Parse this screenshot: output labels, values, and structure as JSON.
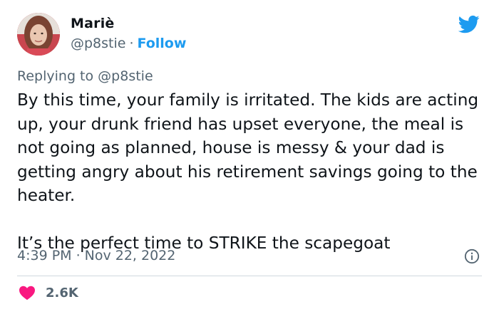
{
  "author": {
    "name": "Mariè",
    "handle": "@p8stie",
    "separator": "·",
    "follow_label": "Follow"
  },
  "reply": {
    "prefix": "Replying to",
    "mention": "@p8stie"
  },
  "tweet": {
    "paragraph1": "By this time, your family is irritated. The kids are acting up, your drunk friend has upset everyone, the meal is not going as planned, house is messy & your dad is getting angry about his retirement savings going to the heater.",
    "paragraph2": "It’s the perfect time to STRIKE the scapegoat"
  },
  "meta": {
    "time": "4:39 PM",
    "separator": "·",
    "date": "Nov 22, 2022"
  },
  "stats": {
    "likes": "2.6K"
  },
  "icons": {
    "brand": "twitter-bird-icon",
    "info": "info-icon",
    "like": "heart-icon"
  },
  "colors": {
    "brand_blue": "#1d9bf0",
    "heart_pink": "#f91880",
    "text_primary": "#0f1419",
    "text_secondary": "#536471",
    "divider": "#cfd9de"
  }
}
